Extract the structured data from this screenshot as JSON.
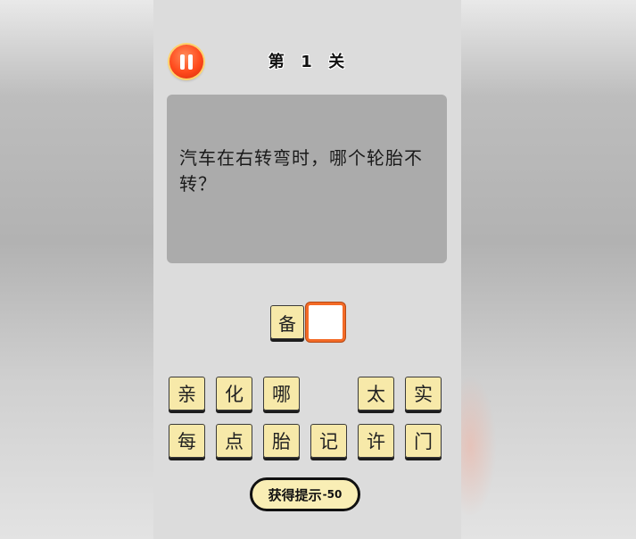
{
  "level": {
    "title": "第  1  关"
  },
  "question": {
    "text": "汽车在右转弯时，哪个轮胎不转？"
  },
  "answer": {
    "slots": [
      "备",
      ""
    ]
  },
  "keyboard": {
    "rows": [
      [
        "亲",
        "化",
        "哪",
        "",
        "太",
        "实"
      ],
      [
        "每",
        "点",
        "胎",
        "记",
        "许",
        "门"
      ]
    ]
  },
  "hint": {
    "label": "获得提示",
    "cost": "-50"
  },
  "colors": {
    "tile": "#f7e9a9",
    "pause": "#ff4a1c",
    "answer_border": "#f36a26",
    "question_bg": "#ababab",
    "hint_bg": "#f9eeb5"
  },
  "icons": {
    "pause": "pause-icon"
  }
}
